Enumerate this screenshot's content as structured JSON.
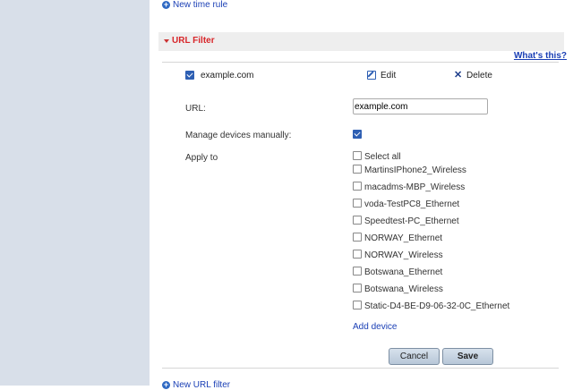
{
  "top_link": {
    "label": "New time rule"
  },
  "section": {
    "title": "URL Filter",
    "help_link": "What's this?"
  },
  "rule": {
    "name": "example.com",
    "checked": true,
    "edit_label": "Edit",
    "delete_label": "Delete"
  },
  "form": {
    "url_label": "URL:",
    "url_value": "example.com",
    "manage_label": "Manage devices manually:",
    "manage_checked": true,
    "apply_label": "Apply to",
    "select_all": "Select all",
    "devices": [
      "MartinsIPhone2_Wireless",
      "macadms-MBP_Wireless",
      "voda-TestPC8_Ethernet",
      "Speedtest-PC_Ethernet",
      "NORWAY_Ethernet",
      "NORWAY_Wireless",
      "Botswana_Ethernet",
      "Botswana_Wireless",
      "Static-D4-BE-D9-06-32-0C_Ethernet"
    ],
    "add_device": "Add device"
  },
  "buttons": {
    "cancel": "Cancel",
    "save": "Save"
  },
  "bottom_link": {
    "label": "New URL filter"
  },
  "colors": {
    "sidebar": "#d8dfe9",
    "section_title": "#d8262a",
    "link": "#1a3fb5"
  }
}
